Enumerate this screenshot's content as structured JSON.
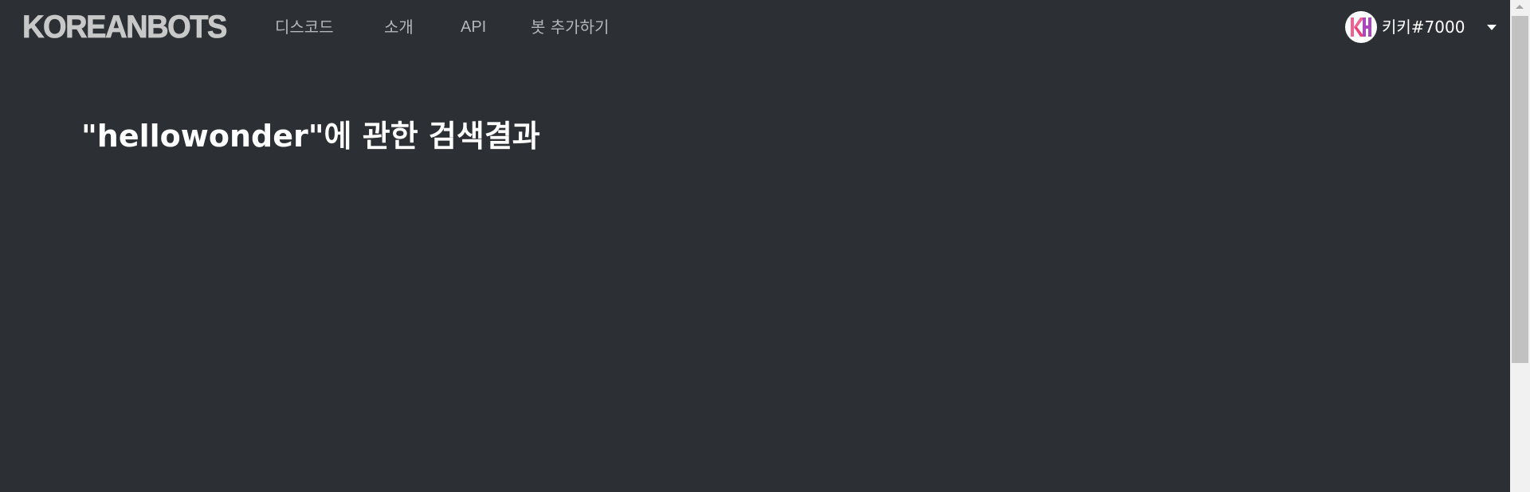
{
  "navbar": {
    "logo": "KOREANBOTS",
    "items": [
      {
        "label": "디스코드"
      },
      {
        "label": "소개"
      },
      {
        "label": "API"
      },
      {
        "label": "봇 추가하기"
      }
    ],
    "user": {
      "avatar_icon": "koreanbots-kh-logo-icon",
      "name": "키키#7000",
      "dropdown_icon": "caret-down-icon"
    }
  },
  "main": {
    "heading": "\"hellowonder\"에 관한 검색결과"
  },
  "colors": {
    "background": "#2c2f33",
    "logo": "#c8c8c8",
    "nav_text": "#b4b6b9",
    "heading": "#ffffff",
    "avatar_pink": "#f06292",
    "avatar_purple": "#ab47bc"
  }
}
